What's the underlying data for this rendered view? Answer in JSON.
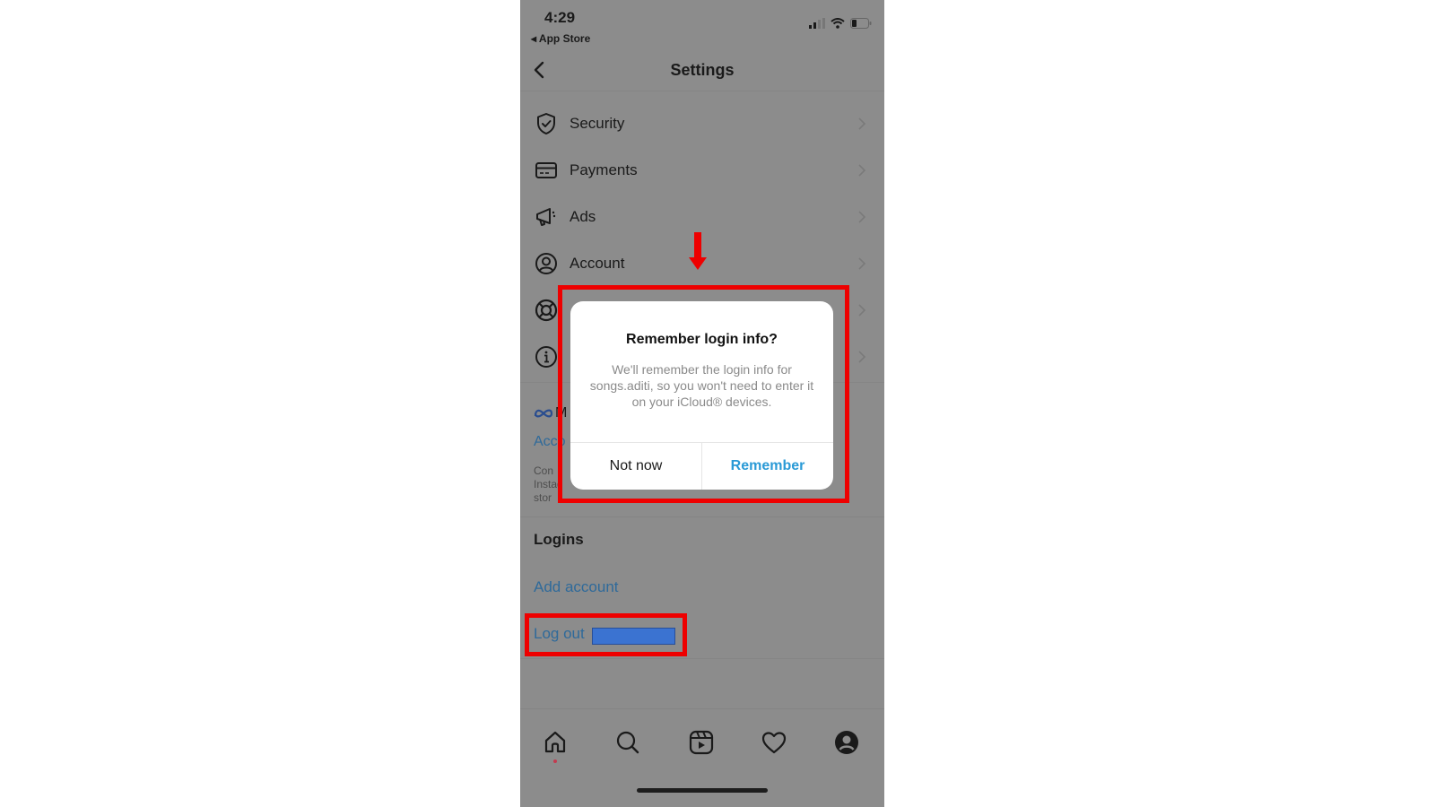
{
  "status_bar": {
    "time": "4:29",
    "back_app": "◂ App Store",
    "icons": [
      "cellular-signal-icon",
      "wifi-icon",
      "battery-icon"
    ]
  },
  "nav": {
    "title": "Settings",
    "back_icon": "chevron-left-icon"
  },
  "menu": {
    "items": [
      {
        "label": "Security",
        "icon": "shield-check-icon"
      },
      {
        "label": "Payments",
        "icon": "credit-card-icon"
      },
      {
        "label": "Ads",
        "icon": "megaphone-icon"
      },
      {
        "label": "Account",
        "icon": "user-circle-icon"
      },
      {
        "label": "",
        "icon": "lifebuoy-icon"
      },
      {
        "label": "",
        "icon": "info-icon"
      }
    ]
  },
  "meta": {
    "logo_partial": "M",
    "accounts_link_partial": "Acco",
    "description_partial_lines": [
      "Con",
      "Instag",
      "stor"
    ]
  },
  "logins": {
    "header": "Logins",
    "add_account": "Add account",
    "log_out": "Log out"
  },
  "dialog": {
    "title": "Remember login info?",
    "message": "We'll remember the login info for songs.aditi, so you won't need to enter it on your iCloud® devices.",
    "buttons": {
      "not_now": "Not now",
      "remember": "Remember"
    }
  },
  "annotations": {
    "highlight_color": "#ee0000",
    "arrow_direction": "down"
  },
  "tab_bar": {
    "tabs": [
      "home-icon",
      "search-icon",
      "reels-icon",
      "heart-icon",
      "profile-icon"
    ],
    "active": "home-icon"
  },
  "colors": {
    "link_blue": "#2f6a9a",
    "remember_blue": "#2a9ad6",
    "overlay_gray": "#8c8c8c",
    "redaction_blue": "#3b73d1"
  }
}
